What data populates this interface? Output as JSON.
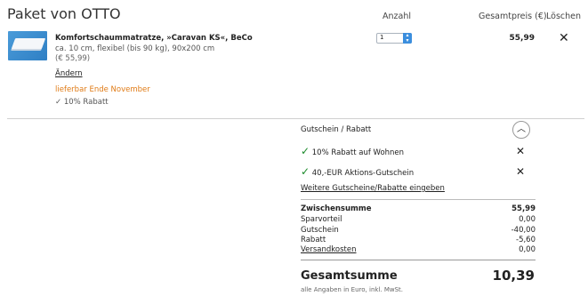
{
  "header": {
    "title": "Paket von OTTO",
    "col_qty": "Anzahl",
    "col_total": "Gesamtpreis (€)",
    "col_delete": "Löschen"
  },
  "item": {
    "name": "Komfortschaummatratze, »Caravan KS«, BeCo",
    "desc": "ca. 10 cm, flexibel (bis 90 kg), 90x200 cm",
    "unit_price": "(€ 55,99)",
    "change_link": "Ändern",
    "delivery": "lieferbar Ende November",
    "discount_check": "✓",
    "discount": "10% Rabatt",
    "quantity": "1",
    "price": "55,99",
    "delete_glyph": "✕"
  },
  "vouchers": {
    "title": "Gutschein / Rabatt",
    "toggle_glyph": "︿",
    "entries": [
      {
        "check": "✓",
        "label": "10% Rabatt auf Wohnen",
        "remove": "✕"
      },
      {
        "check": "✓",
        "label": "40,-EUR Aktions-Gutschein",
        "remove": "✕"
      }
    ],
    "more_link": "Weitere Gutscheine/Rabatte eingeben"
  },
  "summary": {
    "rows": [
      {
        "label": "Zwischensumme",
        "value": "55,99"
      },
      {
        "label": "Sparvorteil",
        "value": "0,00"
      },
      {
        "label": "Gutschein",
        "value": "-40,00"
      },
      {
        "label": "Rabatt",
        "value": "-5,60"
      },
      {
        "label": "Versandkosten",
        "value": "0,00"
      }
    ],
    "total_label": "Gesamtsumme",
    "total_value": "10,39",
    "note": "alle Angaben in Euro, inkl. MwSt."
  },
  "colors": {
    "accent_orange": "#e07b16",
    "check_green": "#1a8a2a",
    "select_blue": "#3b8ede"
  }
}
